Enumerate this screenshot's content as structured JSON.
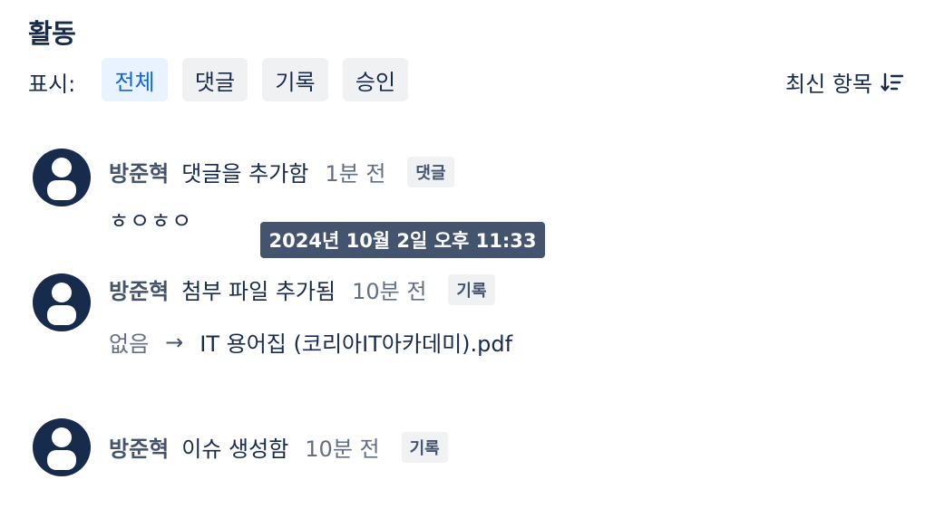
{
  "header": {
    "title": "활동"
  },
  "filters": {
    "label": "표시:",
    "chips": [
      {
        "label": "전체",
        "active": true
      },
      {
        "label": "댓글",
        "active": false
      },
      {
        "label": "기록",
        "active": false
      },
      {
        "label": "승인",
        "active": false
      }
    ]
  },
  "sort": {
    "label": "최신 항목",
    "icon": "sort-descending-icon"
  },
  "entries": [
    {
      "author": "방준혁",
      "action": "댓글을 추가함",
      "time": "1분 전",
      "badge": "댓글",
      "body": "ㅎㅇㅎㅇ"
    },
    {
      "author": "방준혁",
      "action": "첨부 파일 추가됨",
      "time": "10분 전",
      "badge": "기록",
      "change_from": "없음",
      "change_arrow": "→",
      "change_to": "IT 용어집 (코리아IT아카데미).pdf"
    },
    {
      "author": "방준혁",
      "action": "이슈 생성함",
      "time": "10분 전",
      "badge": "기록"
    }
  ],
  "tooltip": {
    "text": "2024년 10월 2일 오후 11:33"
  },
  "colors": {
    "accent": "#0c66e4",
    "text": "#172b4d",
    "subtle": "#626f86",
    "avatar": "#172b4d",
    "tooltip": "#44546f"
  }
}
